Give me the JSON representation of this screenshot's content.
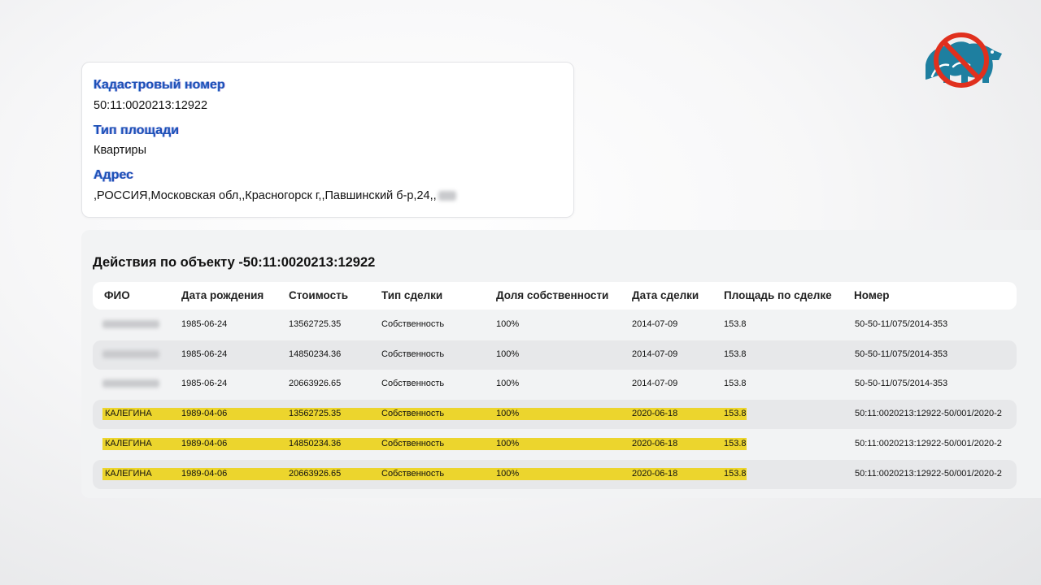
{
  "object_info": {
    "cadastral_label": "Кадастровый номер",
    "cadastral_value": "50:11:0020213:12922",
    "area_type_label": "Тип площади",
    "area_type_value": "Квартиры",
    "address_label": "Адрес",
    "address_value": ",РОССИЯ,Московская обл,,Красногорск г,,Павшинский б-р,24,,"
  },
  "actions": {
    "title": "Действия по объекту -50:11:0020213:12922",
    "columns": [
      "ФИО",
      "Дата рождения",
      "Стоимость",
      "Тип сделки",
      "Доля собственности",
      "Дата сделки",
      "Площадь по сделке",
      "Номер"
    ],
    "rows": [
      {
        "fio": "",
        "birth": "1985-06-24",
        "cost": "13562725.35",
        "type": "Собственность",
        "share": "100%",
        "deal_date": "2014-07-09",
        "area": "153.8",
        "number": "50-50-11/075/2014-353",
        "highlighted": false
      },
      {
        "fio": "",
        "birth": "1985-06-24",
        "cost": "14850234.36",
        "type": "Собственность",
        "share": "100%",
        "deal_date": "2014-07-09",
        "area": "153.8",
        "number": "50-50-11/075/2014-353",
        "highlighted": false
      },
      {
        "fio": "",
        "birth": "1985-06-24",
        "cost": "20663926.65",
        "type": "Собственность",
        "share": "100%",
        "deal_date": "2014-07-09",
        "area": "153.8",
        "number": "50-50-11/075/2014-353",
        "highlighted": false
      },
      {
        "fio": "КАЛЕГИНА",
        "birth": "1989-04-06",
        "cost": "13562725.35",
        "type": "Собственность",
        "share": "100%",
        "deal_date": "2020-06-18",
        "area": "153.8",
        "number": "50:11:0020213:12922-50/001/2020-2",
        "highlighted": true
      },
      {
        "fio": "КАЛЕГИНА",
        "birth": "1989-04-06",
        "cost": "14850234.36",
        "type": "Собственность",
        "share": "100%",
        "deal_date": "2020-06-18",
        "area": "153.8",
        "number": "50:11:0020213:12922-50/001/2020-2",
        "highlighted": true
      },
      {
        "fio": "КАЛЕГИНА",
        "birth": "1989-04-06",
        "cost": "20663926.65",
        "type": "Собственность",
        "share": "100%",
        "deal_date": "2020-06-18",
        "area": "153.8",
        "number": "50:11:0020213:12922-50/001/2020-2",
        "highlighted": true
      }
    ]
  },
  "colors": {
    "label_blue": "#1e4fb4",
    "highlight_yellow": "#ecd52d",
    "logo_red": "#e0301e",
    "logo_teal": "#1e7fa0"
  },
  "logo": {
    "icon": "crossed-out-bear-logo"
  }
}
